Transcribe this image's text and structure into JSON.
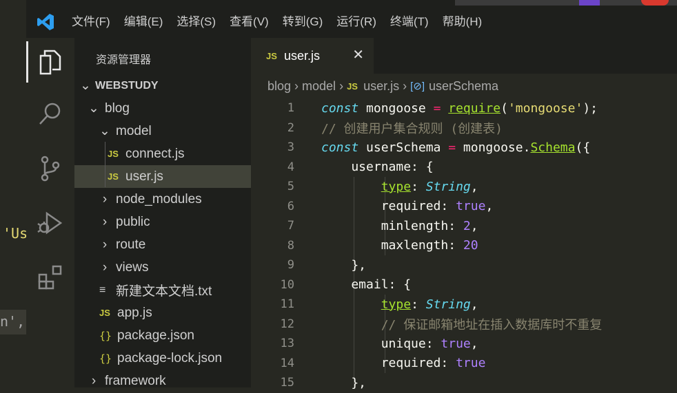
{
  "menu": {
    "items": [
      "文件(F)",
      "编辑(E)",
      "选择(S)",
      "查看(V)",
      "转到(G)",
      "运行(R)",
      "终端(T)",
      "帮助(H)"
    ]
  },
  "background": {
    "snippet_us": "'Us",
    "snippet_n": "n',"
  },
  "sidebar": {
    "title": "资源管理器",
    "workspace": "WEBSTUDY",
    "tree": [
      {
        "label": "blog",
        "kind": "folder-open"
      },
      {
        "label": "model",
        "kind": "folder-open"
      },
      {
        "label": "connect.js",
        "kind": "js"
      },
      {
        "label": "user.js",
        "kind": "js",
        "selected": true
      },
      {
        "label": "node_modules",
        "kind": "folder"
      },
      {
        "label": "public",
        "kind": "folder"
      },
      {
        "label": "route",
        "kind": "folder"
      },
      {
        "label": "views",
        "kind": "folder"
      },
      {
        "label": "新建文本文档.txt",
        "kind": "txt"
      },
      {
        "label": "app.js",
        "kind": "js"
      },
      {
        "label": "package.json",
        "kind": "json"
      },
      {
        "label": "package-lock.json",
        "kind": "json"
      },
      {
        "label": "framework",
        "kind": "folder"
      }
    ]
  },
  "editor": {
    "tab": {
      "badge": "JS",
      "label": "user.js",
      "close": "✕"
    },
    "breadcrumb": [
      "blog",
      "model",
      "user.js",
      "userSchema"
    ],
    "lines": [
      {
        "n": "1",
        "tokens": [
          [
            "kw",
            "const"
          ],
          [
            "t",
            " mongoose "
          ],
          [
            "op",
            "="
          ],
          [
            "t",
            " "
          ],
          [
            "fnu",
            "require"
          ],
          [
            "t",
            "("
          ],
          [
            "str",
            "'mongoose'"
          ],
          [
            "t",
            ");"
          ]
        ]
      },
      {
        "n": "2",
        "tokens": [
          [
            "cm",
            "// 创建用户集合规则 (创建表)"
          ]
        ]
      },
      {
        "n": "3",
        "tokens": [
          [
            "kw",
            "const"
          ],
          [
            "t",
            " userSchema "
          ],
          [
            "op",
            "="
          ],
          [
            "t",
            " mongoose."
          ],
          [
            "fnu",
            "Schema"
          ],
          [
            "t",
            "({"
          ]
        ]
      },
      {
        "n": "4",
        "tokens": [
          [
            "t",
            "    username: {"
          ]
        ]
      },
      {
        "n": "5",
        "tokens": [
          [
            "t",
            "        "
          ],
          [
            "fnu",
            "type"
          ],
          [
            "t",
            ": "
          ],
          [
            "type",
            "String"
          ],
          [
            "t",
            ","
          ]
        ]
      },
      {
        "n": "6",
        "tokens": [
          [
            "t",
            "        required: "
          ],
          [
            "num",
            "true"
          ],
          [
            "t",
            ","
          ]
        ]
      },
      {
        "n": "7",
        "tokens": [
          [
            "t",
            "        minlength: "
          ],
          [
            "num",
            "2"
          ],
          [
            "t",
            ","
          ]
        ]
      },
      {
        "n": "8",
        "tokens": [
          [
            "t",
            "        maxlength: "
          ],
          [
            "num",
            "20"
          ]
        ]
      },
      {
        "n": "9",
        "tokens": [
          [
            "t",
            "    },"
          ]
        ]
      },
      {
        "n": "10",
        "tokens": [
          [
            "t",
            "    email: {"
          ]
        ]
      },
      {
        "n": "11",
        "tokens": [
          [
            "t",
            "        "
          ],
          [
            "fnu",
            "type"
          ],
          [
            "t",
            ": "
          ],
          [
            "type",
            "String"
          ],
          [
            "t",
            ","
          ]
        ]
      },
      {
        "n": "12",
        "tokens": [
          [
            "t",
            "        "
          ],
          [
            "cm",
            "// 保证邮箱地址在插入数据库时不重复"
          ]
        ]
      },
      {
        "n": "13",
        "tokens": [
          [
            "t",
            "        unique: "
          ],
          [
            "num",
            "true"
          ],
          [
            "t",
            ","
          ]
        ]
      },
      {
        "n": "14",
        "tokens": [
          [
            "t",
            "        required: "
          ],
          [
            "num",
            "true"
          ]
        ]
      },
      {
        "n": "15",
        "tokens": [
          [
            "t",
            "    },"
          ]
        ]
      }
    ]
  },
  "colors": {
    "keyword": "#66d9ef",
    "string": "#e6db74",
    "number": "#ae81ff",
    "comment": "#88846f",
    "function": "#a6e22e",
    "operator": "#f92672"
  }
}
